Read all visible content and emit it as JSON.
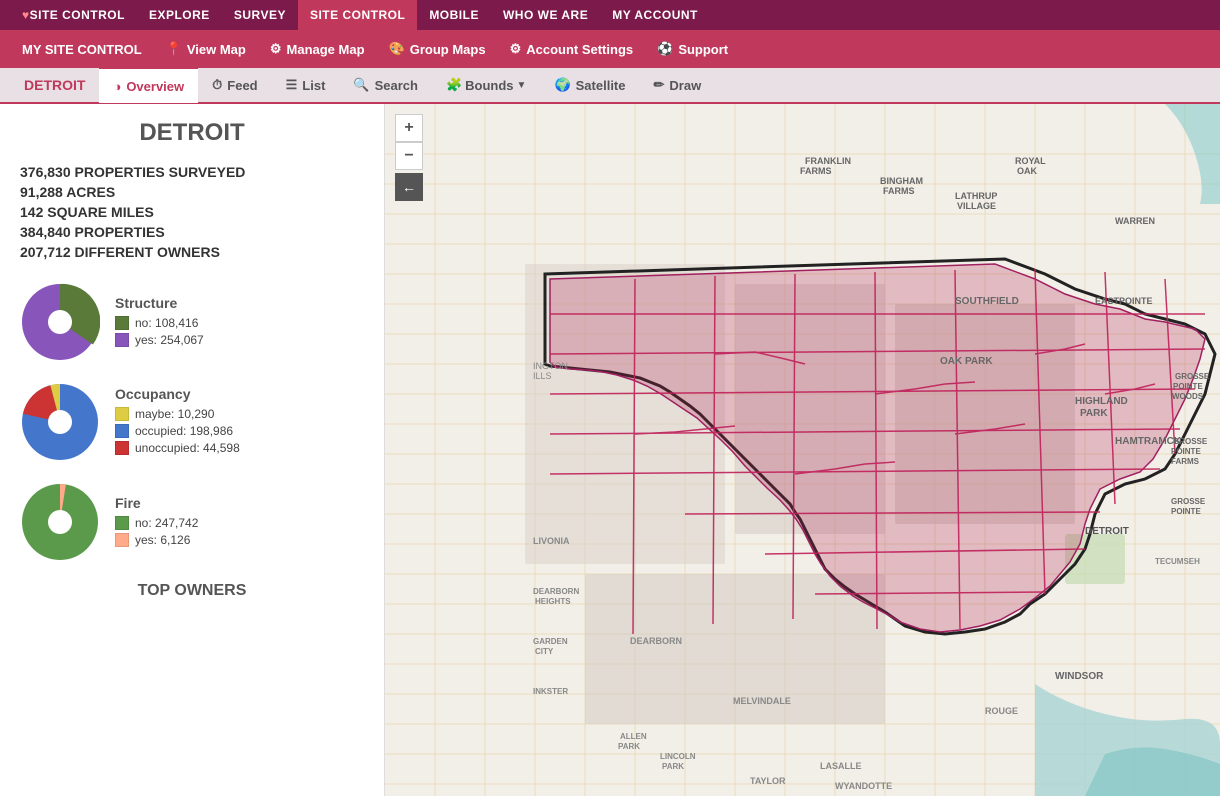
{
  "topNav": {
    "items": [
      {
        "label": "SITE CONTROL",
        "id": "site-control-logo",
        "icon": "heart",
        "active": false
      },
      {
        "label": "EXPLORE",
        "id": "explore",
        "active": false
      },
      {
        "label": "SURVEY",
        "id": "survey",
        "active": false
      },
      {
        "label": "SITE CONTROL",
        "id": "site-control-active",
        "active": true
      },
      {
        "label": "MOBILE",
        "id": "mobile",
        "active": false
      },
      {
        "label": "WHO WE ARE",
        "id": "who-we-are",
        "active": false
      },
      {
        "label": "MY ACCOUNT",
        "id": "my-account",
        "active": false
      }
    ]
  },
  "secondNav": {
    "items": [
      {
        "label": "MY SITE CONTROL",
        "id": "my-site-control"
      },
      {
        "label": "View Map",
        "id": "view-map",
        "icon": "📍"
      },
      {
        "label": "Manage Map",
        "id": "manage-map",
        "icon": "⚙"
      },
      {
        "label": "Group Maps",
        "id": "group-maps",
        "icon": "🎨"
      },
      {
        "label": "Account Settings",
        "id": "account-settings",
        "icon": "⚙"
      },
      {
        "label": "Support",
        "id": "support",
        "icon": "⚽"
      }
    ]
  },
  "tabNav": {
    "cityName": "DETROIT",
    "tabs": [
      {
        "label": "Overview",
        "id": "overview",
        "active": true,
        "icon": "◑"
      },
      {
        "label": "Feed",
        "id": "feed",
        "icon": "⏱"
      },
      {
        "label": "List",
        "id": "list",
        "icon": "☰"
      },
      {
        "label": "Search",
        "id": "search",
        "icon": "🔍"
      },
      {
        "label": "Bounds",
        "id": "bounds",
        "icon": "🧩",
        "hasDropdown": true
      },
      {
        "label": "Satellite",
        "id": "satellite",
        "icon": "🌍"
      },
      {
        "label": "Draw",
        "id": "draw",
        "icon": "✏"
      }
    ]
  },
  "sidebar": {
    "cityTitle": "DETROIT",
    "stats": [
      {
        "value": "376,830 PROPERTIES SURVEYED"
      },
      {
        "value": "91,288 ACRES"
      },
      {
        "value": "142 SQUARE MILES"
      },
      {
        "value": "384,840 PROPERTIES"
      },
      {
        "value": "207,712 DIFFERENT OWNERS"
      }
    ],
    "charts": [
      {
        "id": "structure",
        "title": "Structure",
        "legend": [
          {
            "color": "#5a7a3a",
            "label": "no: 108,416"
          },
          {
            "color": "#8855bb",
            "label": "yes: 254,067"
          }
        ],
        "slices": [
          {
            "value": 108416,
            "color": "#5a7a3a"
          },
          {
            "value": 254067,
            "color": "#8855bb"
          }
        ]
      },
      {
        "id": "occupancy",
        "title": "Occupancy",
        "legend": [
          {
            "color": "#ddcc44",
            "label": "maybe: 10,290"
          },
          {
            "color": "#4477cc",
            "label": "occupied: 198,986"
          },
          {
            "color": "#cc3333",
            "label": "unoccupied: 44,598"
          }
        ],
        "slices": [
          {
            "value": 10290,
            "color": "#ddcc44"
          },
          {
            "value": 198986,
            "color": "#4477cc"
          },
          {
            "value": 44598,
            "color": "#cc3333"
          }
        ]
      },
      {
        "id": "fire",
        "title": "Fire",
        "legend": [
          {
            "color": "#5a9a4a",
            "label": "no: 247,742"
          },
          {
            "color": "#ffaa88",
            "label": "yes: 6,126"
          }
        ],
        "slices": [
          {
            "value": 247742,
            "color": "#5a9a4a"
          },
          {
            "value": 6126,
            "color": "#ffaa88"
          }
        ]
      }
    ],
    "topOwnersTitle": "TOP OWNERS"
  },
  "map": {
    "zoomIn": "+",
    "zoomOut": "−",
    "backArrow": "←"
  }
}
